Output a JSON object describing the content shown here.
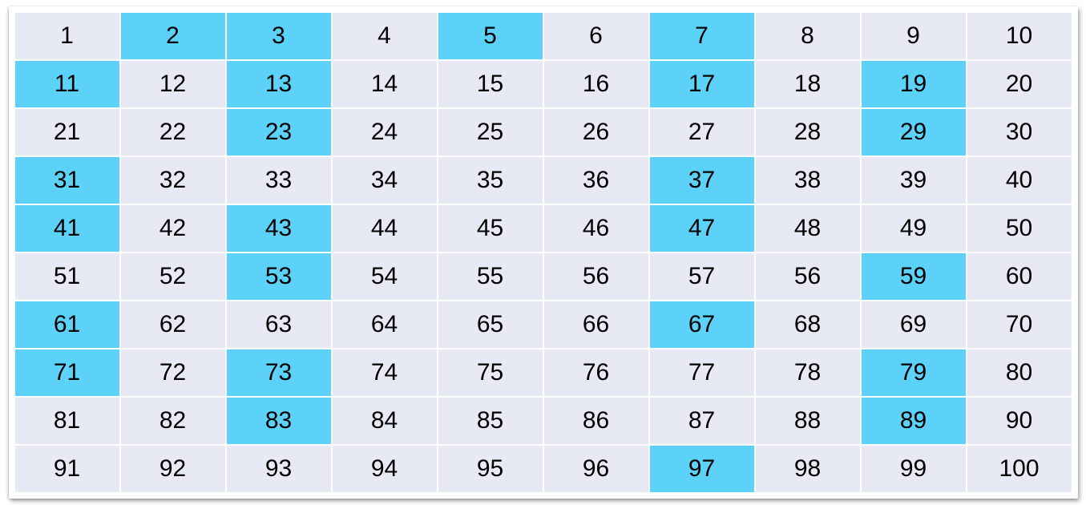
{
  "chart_data": {
    "type": "table",
    "title": "",
    "columns": 10,
    "rows": 10,
    "highlight_color": "#5dd2f8",
    "base_color": "#e7e9f5",
    "cells": [
      [
        {
          "v": 1,
          "h": false
        },
        {
          "v": 2,
          "h": true
        },
        {
          "v": 3,
          "h": true
        },
        {
          "v": 4,
          "h": false
        },
        {
          "v": 5,
          "h": true
        },
        {
          "v": 6,
          "h": false
        },
        {
          "v": 7,
          "h": true
        },
        {
          "v": 8,
          "h": false
        },
        {
          "v": 9,
          "h": false
        },
        {
          "v": 10,
          "h": false
        }
      ],
      [
        {
          "v": 11,
          "h": true
        },
        {
          "v": 12,
          "h": false
        },
        {
          "v": 13,
          "h": true
        },
        {
          "v": 14,
          "h": false
        },
        {
          "v": 15,
          "h": false
        },
        {
          "v": 16,
          "h": false
        },
        {
          "v": 17,
          "h": true
        },
        {
          "v": 18,
          "h": false
        },
        {
          "v": 19,
          "h": true
        },
        {
          "v": 20,
          "h": false
        }
      ],
      [
        {
          "v": 21,
          "h": false
        },
        {
          "v": 22,
          "h": false
        },
        {
          "v": 23,
          "h": true
        },
        {
          "v": 24,
          "h": false
        },
        {
          "v": 25,
          "h": false
        },
        {
          "v": 26,
          "h": false
        },
        {
          "v": 27,
          "h": false
        },
        {
          "v": 28,
          "h": false
        },
        {
          "v": 29,
          "h": true
        },
        {
          "v": 30,
          "h": false
        }
      ],
      [
        {
          "v": 31,
          "h": true
        },
        {
          "v": 32,
          "h": false
        },
        {
          "v": 33,
          "h": false
        },
        {
          "v": 34,
          "h": false
        },
        {
          "v": 35,
          "h": false
        },
        {
          "v": 36,
          "h": false
        },
        {
          "v": 37,
          "h": true
        },
        {
          "v": 38,
          "h": false
        },
        {
          "v": 39,
          "h": false
        },
        {
          "v": 40,
          "h": false
        }
      ],
      [
        {
          "v": 41,
          "h": true
        },
        {
          "v": 42,
          "h": false
        },
        {
          "v": 43,
          "h": true
        },
        {
          "v": 44,
          "h": false
        },
        {
          "v": 45,
          "h": false
        },
        {
          "v": 46,
          "h": false
        },
        {
          "v": 47,
          "h": true
        },
        {
          "v": 48,
          "h": false
        },
        {
          "v": 49,
          "h": false
        },
        {
          "v": 50,
          "h": false
        }
      ],
      [
        {
          "v": 51,
          "h": false
        },
        {
          "v": 52,
          "h": false
        },
        {
          "v": 53,
          "h": true
        },
        {
          "v": 54,
          "h": false
        },
        {
          "v": 55,
          "h": false
        },
        {
          "v": 56,
          "h": false
        },
        {
          "v": 57,
          "h": false
        },
        {
          "v": 56,
          "h": false
        },
        {
          "v": 59,
          "h": true
        },
        {
          "v": 60,
          "h": false
        }
      ],
      [
        {
          "v": 61,
          "h": true
        },
        {
          "v": 62,
          "h": false
        },
        {
          "v": 63,
          "h": false
        },
        {
          "v": 64,
          "h": false
        },
        {
          "v": 65,
          "h": false
        },
        {
          "v": 66,
          "h": false
        },
        {
          "v": 67,
          "h": true
        },
        {
          "v": 68,
          "h": false
        },
        {
          "v": 69,
          "h": false
        },
        {
          "v": 70,
          "h": false
        }
      ],
      [
        {
          "v": 71,
          "h": true
        },
        {
          "v": 72,
          "h": false
        },
        {
          "v": 73,
          "h": true
        },
        {
          "v": 74,
          "h": false
        },
        {
          "v": 75,
          "h": false
        },
        {
          "v": 76,
          "h": false
        },
        {
          "v": 77,
          "h": false
        },
        {
          "v": 78,
          "h": false
        },
        {
          "v": 79,
          "h": true
        },
        {
          "v": 80,
          "h": false
        }
      ],
      [
        {
          "v": 81,
          "h": false
        },
        {
          "v": 82,
          "h": false
        },
        {
          "v": 83,
          "h": true
        },
        {
          "v": 84,
          "h": false
        },
        {
          "v": 85,
          "h": false
        },
        {
          "v": 86,
          "h": false
        },
        {
          "v": 87,
          "h": false
        },
        {
          "v": 88,
          "h": false
        },
        {
          "v": 89,
          "h": true
        },
        {
          "v": 90,
          "h": false
        }
      ],
      [
        {
          "v": 91,
          "h": false
        },
        {
          "v": 92,
          "h": false
        },
        {
          "v": 93,
          "h": false
        },
        {
          "v": 94,
          "h": false
        },
        {
          "v": 95,
          "h": false
        },
        {
          "v": 96,
          "h": false
        },
        {
          "v": 97,
          "h": true
        },
        {
          "v": 98,
          "h": false
        },
        {
          "v": 99,
          "h": false
        },
        {
          "v": 100,
          "h": false
        }
      ]
    ]
  }
}
